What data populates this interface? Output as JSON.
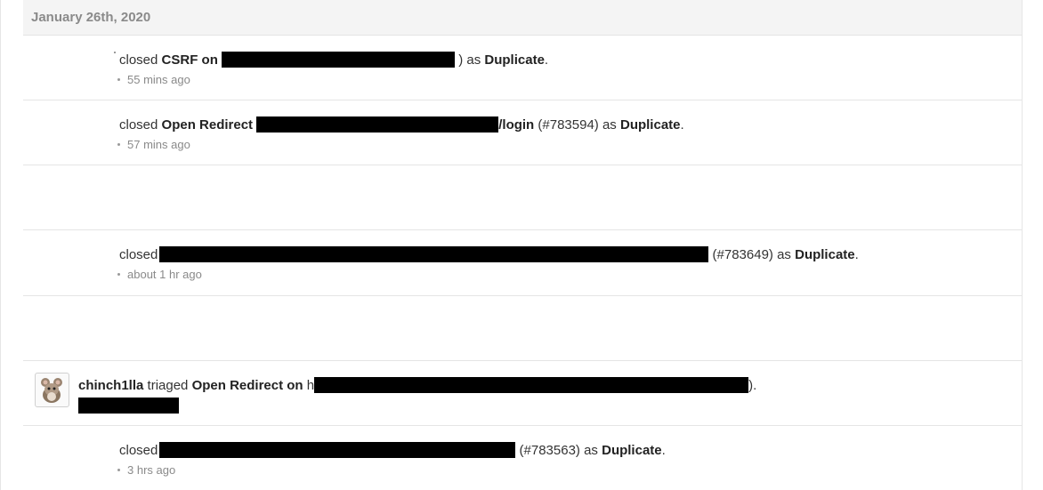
{
  "date": "January 26th, 2020",
  "entries": [
    {
      "verb": "closed",
      "title": "CSRF on",
      "suffix": ") as",
      "status": "Duplicate",
      "end": ".",
      "time": "55 mins ago"
    },
    {
      "verb": "closed",
      "title": "Open Redirect",
      "tail": "/login",
      "ref": "(#783594) as",
      "status": "Duplicate",
      "end": ".",
      "time": "57 mins ago"
    },
    {
      "verb": "closed",
      "ref": "(#783649) as",
      "status": "Duplicate",
      "end": ".",
      "time": "about 1 hr ago"
    },
    {
      "user": "chinch1lla",
      "verb": "triaged",
      "title": "Open Redirect on",
      "lead": "h",
      "end": ")."
    },
    {
      "verb": "closed",
      "ref": "(#783563) as",
      "status": "Duplicate",
      "end": ".",
      "time": "3 hrs ago"
    }
  ],
  "icons": {
    "avatar": "chinchilla-avatar-icon"
  }
}
